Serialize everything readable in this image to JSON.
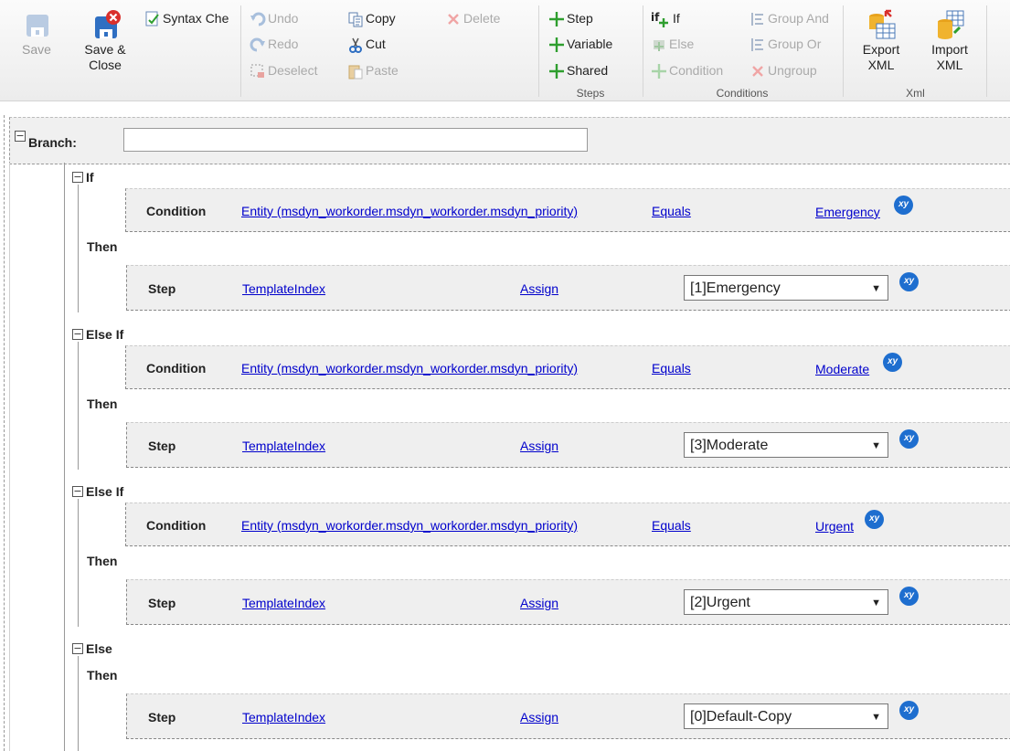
{
  "ribbon": {
    "save": "Save",
    "save_close": [
      "Save &",
      "Close"
    ],
    "syntax_check": "Syntax Che",
    "undo": "Undo",
    "redo": "Redo",
    "deselect": "Deselect",
    "copy": "Copy",
    "cut": "Cut",
    "paste": "Paste",
    "delete": "Delete",
    "steps": {
      "step": "Step",
      "variable": "Variable",
      "shared": "Shared",
      "label": "Steps"
    },
    "conditions": {
      "if": "If",
      "else": "Else",
      "condition": "Condition",
      "group_and": "Group And",
      "group_or": "Group Or",
      "ungroup": "Ungroup",
      "label": "Conditions",
      "if_icon_text": "if"
    },
    "xml": {
      "export": [
        "Export",
        "XML"
      ],
      "import": [
        "Import",
        "XML"
      ],
      "label": "Xml"
    }
  },
  "branch": {
    "label": "Branch:",
    "value": ""
  },
  "blocks": [
    {
      "header": "If",
      "condition": {
        "label": "Condition",
        "field": "Entity (msdyn_workorder.msdyn_workorder.msdyn_priority)",
        "operator": "Equals",
        "value": "Emergency"
      },
      "then": "Then",
      "step": {
        "label": "Step",
        "field": "TemplateIndex",
        "action": "Assign",
        "value": "[1]Emergency"
      }
    },
    {
      "header": "Else If",
      "condition": {
        "label": "Condition",
        "field": "Entity (msdyn_workorder.msdyn_workorder.msdyn_priority)",
        "operator": "Equals",
        "value": "Moderate"
      },
      "then": "Then",
      "step": {
        "label": "Step",
        "field": "TemplateIndex",
        "action": "Assign",
        "value": "[3]Moderate"
      }
    },
    {
      "header": "Else If",
      "condition": {
        "label": "Condition",
        "field": "Entity (msdyn_workorder.msdyn_workorder.msdyn_priority)",
        "operator": "Equals",
        "value": "Urgent"
      },
      "then": "Then",
      "step": {
        "label": "Step",
        "field": "TemplateIndex",
        "action": "Assign",
        "value": "[2]Urgent"
      }
    },
    {
      "header": "Else",
      "then": "Then",
      "step": {
        "label": "Step",
        "field": "TemplateIndex",
        "action": "Assign",
        "value": "[0]Default-Copy"
      }
    }
  ],
  "xy_badge": "xy",
  "toggle_glyph": "−",
  "colors": {
    "link": "#0000cc",
    "badge": "#1e6ecf",
    "add_green": "#2e9e2e",
    "delete_red": "#e23b3b"
  }
}
